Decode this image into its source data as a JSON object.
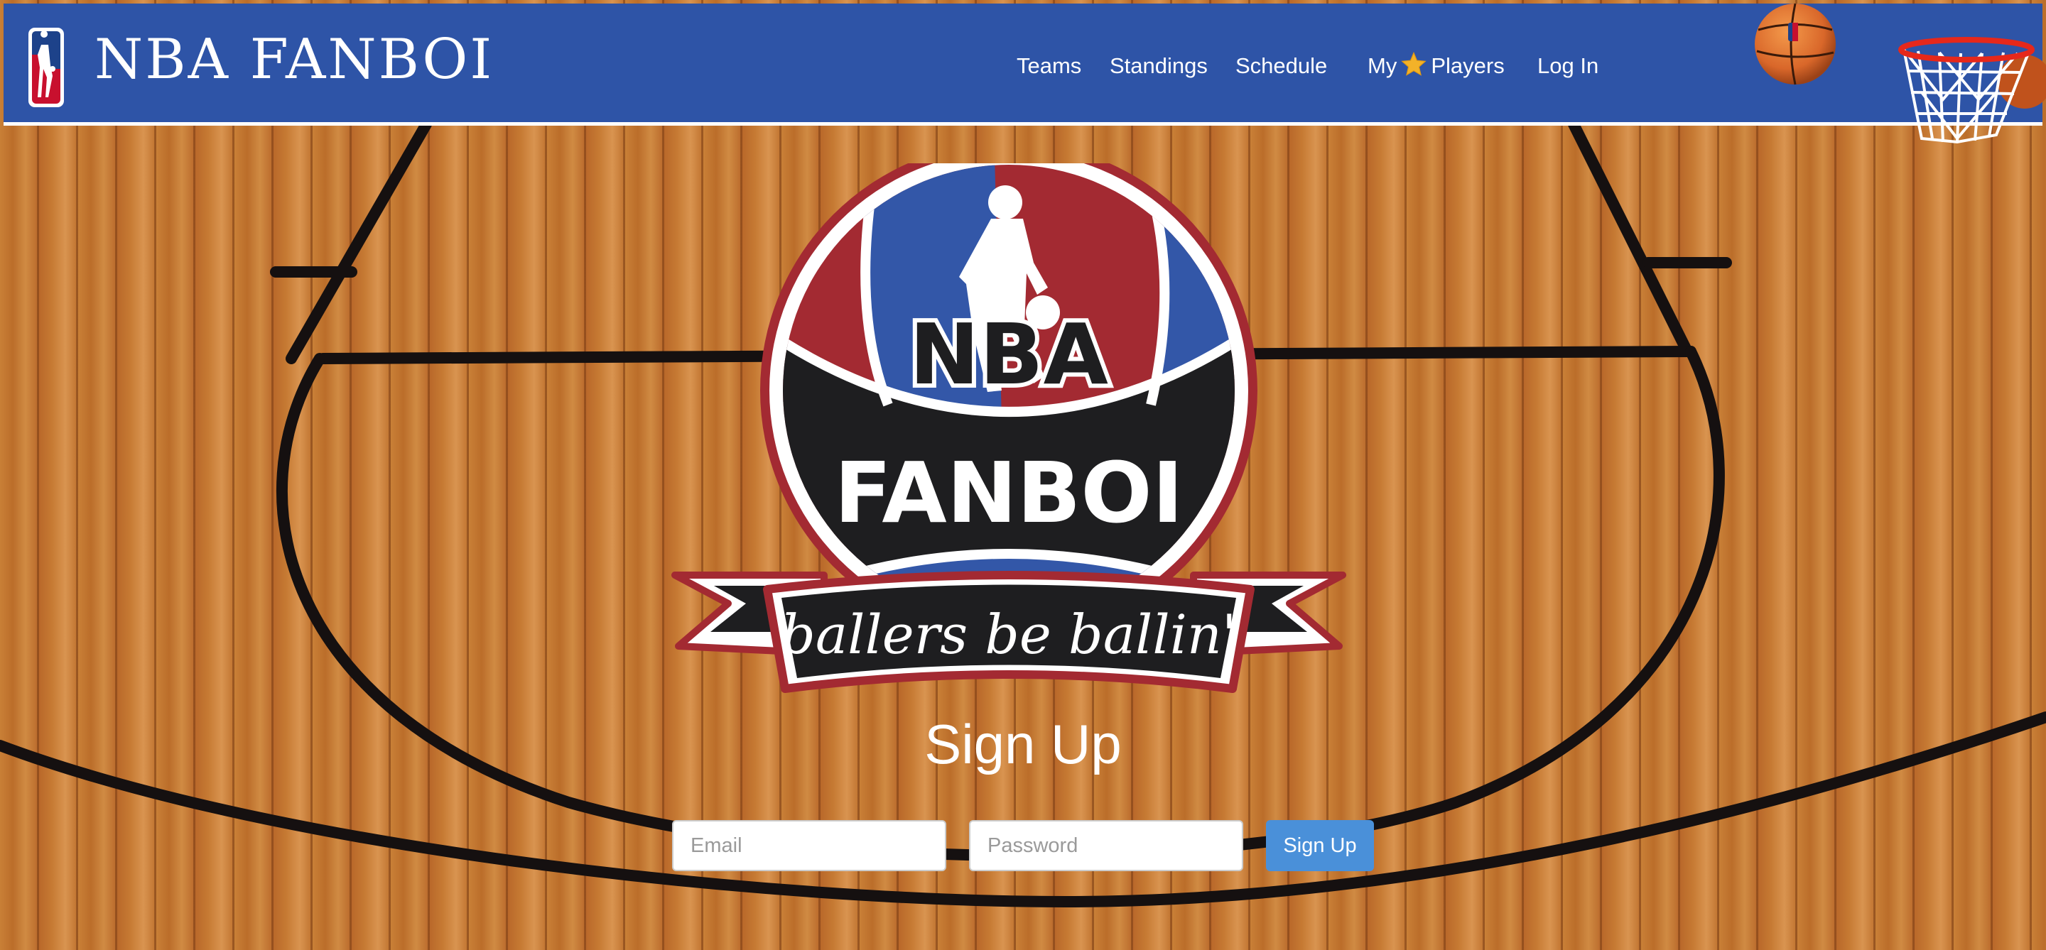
{
  "header": {
    "brand": "NBA FANBOI",
    "nav": {
      "teams": "Teams",
      "standings": "Standings",
      "schedule": "Schedule",
      "my_players_prefix": "My",
      "my_players_suffix": "Players",
      "login": "Log In"
    },
    "icons": {
      "brand_logo": "nba-logo-icon",
      "star": "star-icon",
      "ball": "basketball-icon",
      "hoop": "basketball-hoop-icon"
    }
  },
  "hero_logo": {
    "line1": "NBA",
    "line2": "FANBOI",
    "banner": "ballers be ballin'"
  },
  "signup": {
    "title": "Sign Up",
    "email_placeholder": "Email",
    "password_placeholder": "Password",
    "button_label": "Sign Up"
  },
  "colors": {
    "header_blue": "#2e54a7",
    "logo_red": "#a32a32",
    "logo_blue": "#3357a8",
    "logo_black": "#1e1e20",
    "button_blue": "#4a90d9",
    "star_gold": "#f3b229"
  }
}
